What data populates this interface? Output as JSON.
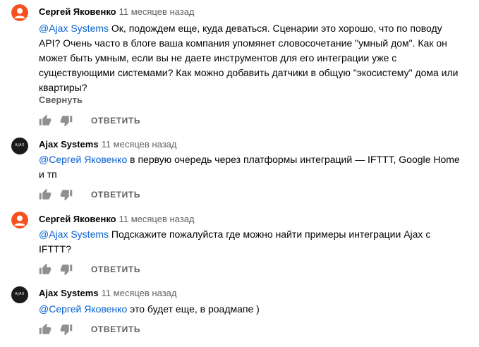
{
  "comments": [
    {
      "author": "Сергей Яковенко",
      "time": "11 месяцев назад",
      "mention": "@Ajax Systems",
      "text": " Ок, подождем еще, куда деваться. Сценарии это хорошо, что по поводу API? Очень часто в блоге ваша компания упомянет словосочетание \"умный дом\". Как он может быть умным, если вы не даете инструментов для его интеграции уже с существующими системами? Как можно добавить датчики в общую \"экосистему\" дома или квартиры?",
      "collapse": "Свернуть",
      "reply": "ОТВЕТИТЬ",
      "avatar_icon": "user-orange-icon"
    },
    {
      "author": "Ajax Systems",
      "time": "11 месяцев назад",
      "mention": "@Сергей Яковенко",
      "text": " в первую очередь через платформы интеграций — IFTTT, Google Home и тп",
      "reply": "ОТВЕТИТЬ",
      "avatar_text": "AJAX"
    },
    {
      "author": "Сергей Яковенко",
      "time": "11 месяцев назад",
      "mention": "@Ajax Systems",
      "text": " Подскажите пожалуйста где можно найти примеры интеграции Ajax с IFTTT?",
      "reply": "ОТВЕТИТЬ",
      "avatar_icon": "user-orange-icon"
    },
    {
      "author": "Ajax Systems",
      "time": "11 месяцев назад",
      "mention": "@Сергей Яковенко",
      "text": " это будет еще, в роадмапе )",
      "reply": "ОТВЕТИТЬ",
      "avatar_text": "AJAX"
    }
  ],
  "colors": {
    "mention": "#065fd4",
    "avatar_orange": "#f4511e",
    "avatar_dark": "#1a1a1a",
    "secondary_text": "#606060"
  }
}
